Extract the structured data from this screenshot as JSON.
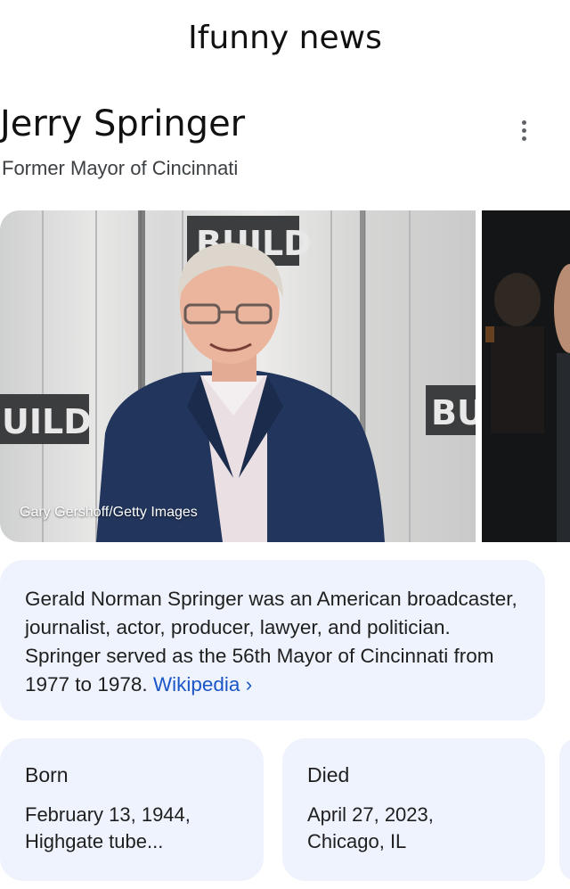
{
  "header": {
    "title": "Ifunny news"
  },
  "entity": {
    "name": "Jerry Springer",
    "subtitle": "Former Mayor of Cincinnati"
  },
  "image": {
    "caption": "Gary Gershoff/Getty Images",
    "backdrop_left": "UILD",
    "backdrop_top": "BUILD",
    "backdrop_right": "BU"
  },
  "description": {
    "text": "Gerald Norman Springer was an American broadcaster, journalist, actor, producer, lawyer, and politician. Springer served as the 56th Mayor of Cincinnati from 1977 to 1978.",
    "link_label": "Wikipedia ›"
  },
  "facts": [
    {
      "label": "Born",
      "line1": "February 13, 1944,",
      "line2": "Highgate tube..."
    },
    {
      "label": "Died",
      "line1": "April 27, 2023,",
      "line2": "Chicago, IL"
    }
  ],
  "colors": {
    "card": "#eef3fd",
    "link": "#1a56c8",
    "text": "#1f1f1f"
  },
  "icons": {
    "more": "more-vert-icon",
    "chevron": "chevron-right-icon"
  }
}
